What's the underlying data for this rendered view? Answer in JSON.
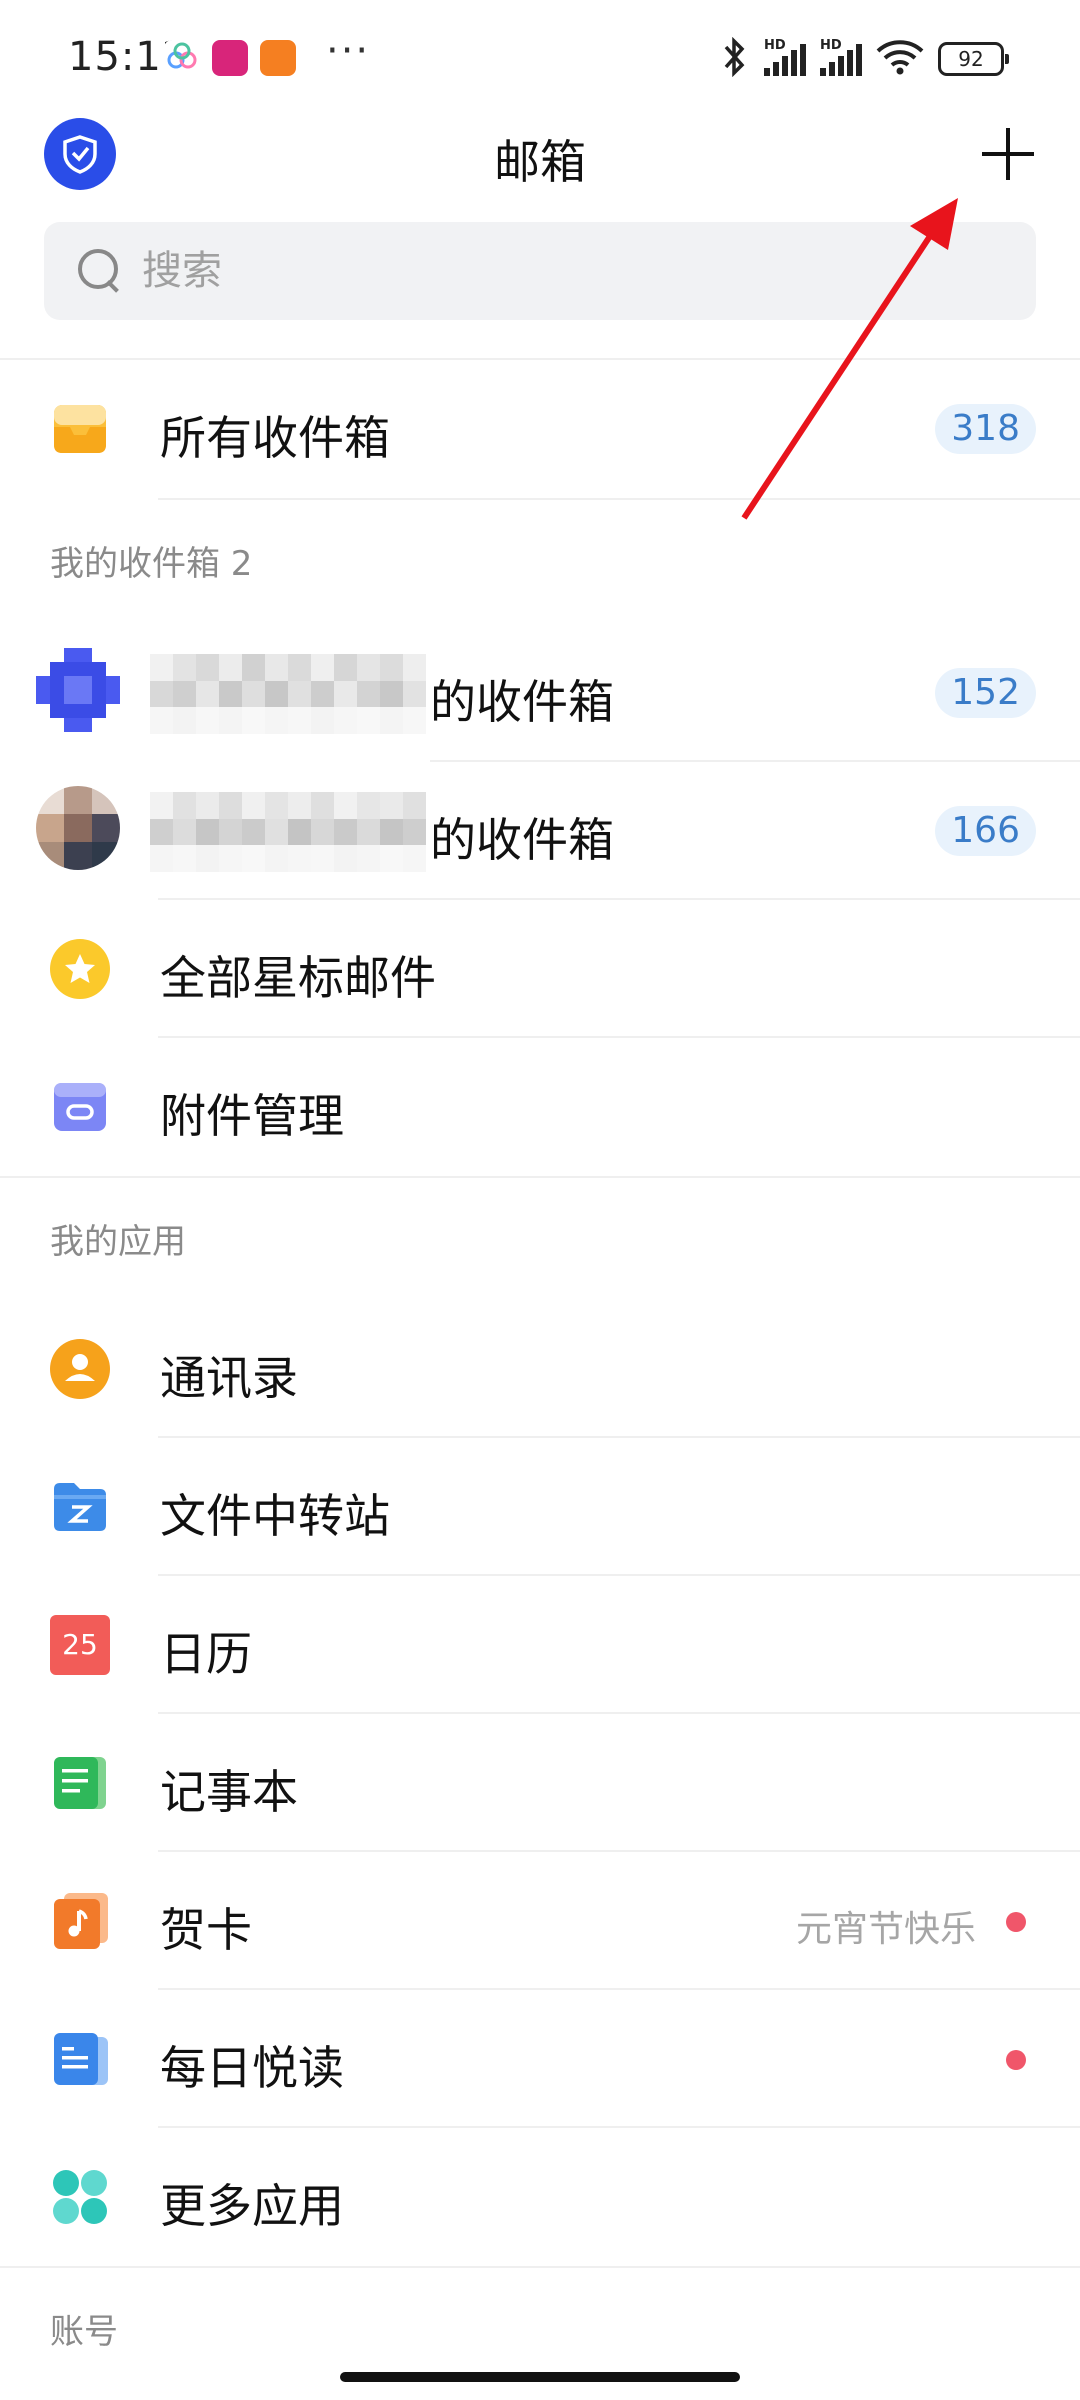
{
  "status_bar": {
    "time": "15:12",
    "app_icons": [
      "cloud-app-icon",
      "shopping-app-icon",
      "orange-app-icon"
    ],
    "more": "···",
    "signal_label": "HD",
    "battery": "92"
  },
  "header": {
    "title": "邮箱"
  },
  "search": {
    "placeholder": "搜索"
  },
  "main_list": {
    "all_inbox": {
      "label": "所有收件箱",
      "count": "318"
    }
  },
  "my_inboxes": {
    "title": "我的收件箱 2",
    "items": [
      {
        "label": "的收件箱",
        "count": "152"
      },
      {
        "label": "的收件箱",
        "count": "166"
      }
    ],
    "starred": {
      "label": "全部星标邮件"
    },
    "attachments": {
      "label": "附件管理"
    }
  },
  "my_apps": {
    "title": "我的应用",
    "items": [
      {
        "label": "通讯录",
        "icon": "contacts-icon"
      },
      {
        "label": "文件中转站",
        "icon": "file-transfer-icon"
      },
      {
        "label": "日历",
        "icon": "calendar-icon",
        "icon_text": "25"
      },
      {
        "label": "记事本",
        "icon": "notepad-icon"
      },
      {
        "label": "贺卡",
        "icon": "greeting-card-icon",
        "trail": "元宵节快乐"
      },
      {
        "label": "每日悦读",
        "icon": "daily-reading-icon"
      },
      {
        "label": "更多应用",
        "icon": "more-apps-icon"
      }
    ]
  },
  "account": {
    "title": "账号"
  },
  "colors": {
    "accent": "#2a4de8",
    "badge_bg": "#e8f2fc",
    "badge_text": "#3a7cc8",
    "red_dot": "#f0566a"
  }
}
